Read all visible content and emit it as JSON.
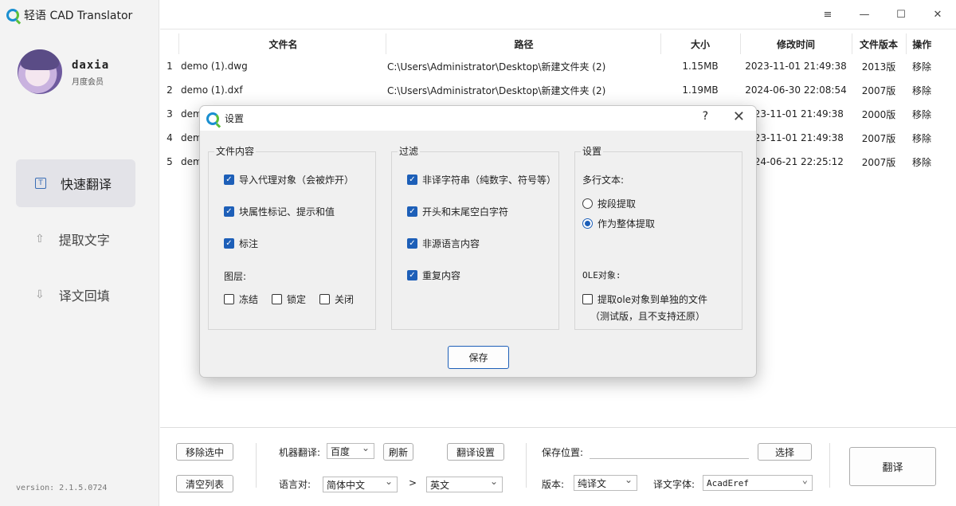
{
  "app": {
    "title": "轻语 CAD Translator",
    "version": "version: 2.1.5.0724"
  },
  "user": {
    "name": "daxia",
    "membership": "月度会员"
  },
  "nav": [
    {
      "label": "快速翻译",
      "icon": "T"
    },
    {
      "label": "提取文字",
      "icon": "upload"
    },
    {
      "label": "译文回填",
      "icon": "download"
    }
  ],
  "window": {
    "minimize": "—",
    "maximize": "☐",
    "close": "✕",
    "menu": "≡"
  },
  "table": {
    "headers": [
      "文件名",
      "路径",
      "大小",
      "修改时间",
      "文件版本",
      "操作"
    ],
    "rows": [
      {
        "idx": "1",
        "name": "demo (1).dwg",
        "path": "C:\\Users\\Administrator\\Desktop\\新建文件夹 (2)",
        "size": "1.15MB",
        "time": "2023-11-01 21:49:38",
        "ver": "2013版",
        "op": "移除"
      },
      {
        "idx": "2",
        "name": "demo (1).dxf",
        "path": "C:\\Users\\Administrator\\Desktop\\新建文件夹 (2)",
        "size": "1.19MB",
        "time": "2024-06-30 22:08:54",
        "ver": "2007版",
        "op": "移除"
      },
      {
        "idx": "3",
        "name": "dem",
        "path": "",
        "size": "",
        "time": "023-11-01 21:49:38",
        "ver": "2000版",
        "op": "移除"
      },
      {
        "idx": "4",
        "name": "dem",
        "path": "",
        "size": "",
        "time": "023-11-01 21:49:38",
        "ver": "2007版",
        "op": "移除"
      },
      {
        "idx": "5",
        "name": "dem",
        "path": "",
        "size": "",
        "time": "024-06-21 22:25:12",
        "ver": "2007版",
        "op": "移除"
      }
    ]
  },
  "bottom": {
    "remove_selected": "移除选中",
    "clear_list": "清空列表",
    "engine_label": "机器翻译:",
    "engine_value": "百度",
    "refresh": "刷新",
    "translate_settings": "翻译设置",
    "lang_label": "语言对:",
    "lang_from": "简体中文",
    "arrow": ">",
    "lang_to": "英文",
    "save_location_label": "保存位置:",
    "save_location_value": "",
    "choose": "选择",
    "version_label": "版本:",
    "version_value": "纯译文",
    "font_label": "译文字体:",
    "font_value": "AcadEref",
    "translate": "翻译"
  },
  "dialog": {
    "title": "设置",
    "help": "?",
    "close": "✕",
    "content_group": {
      "title": "文件内容",
      "items": [
        {
          "label": "导入代理对象（会被炸开）",
          "checked": true
        },
        {
          "label": "块属性标记、提示和值",
          "checked": true
        },
        {
          "label": "标注",
          "checked": true
        }
      ],
      "layer_label": "图层:",
      "layers": [
        {
          "label": "冻结",
          "checked": false
        },
        {
          "label": "锁定",
          "checked": false
        },
        {
          "label": "关闭",
          "checked": false
        }
      ]
    },
    "filter_group": {
      "title": "过滤",
      "items": [
        {
          "label": "非译字符串（纯数字、符号等）",
          "checked": true
        },
        {
          "label": "开头和末尾空白字符",
          "checked": true
        },
        {
          "label": "非源语言内容",
          "checked": true
        },
        {
          "label": "重复内容",
          "checked": true
        }
      ]
    },
    "settings_group": {
      "title": "设置",
      "multiline_label": "多行文本:",
      "radios": [
        {
          "label": "按段提取",
          "checked": false
        },
        {
          "label": "作为整体提取",
          "checked": true
        }
      ],
      "ole_label": "OLE对象:",
      "ole_option": {
        "label": "提取ole对象到单独的文件",
        "checked": false
      },
      "ole_note": "（测试版，且不支持还原）"
    },
    "save": "保存"
  }
}
